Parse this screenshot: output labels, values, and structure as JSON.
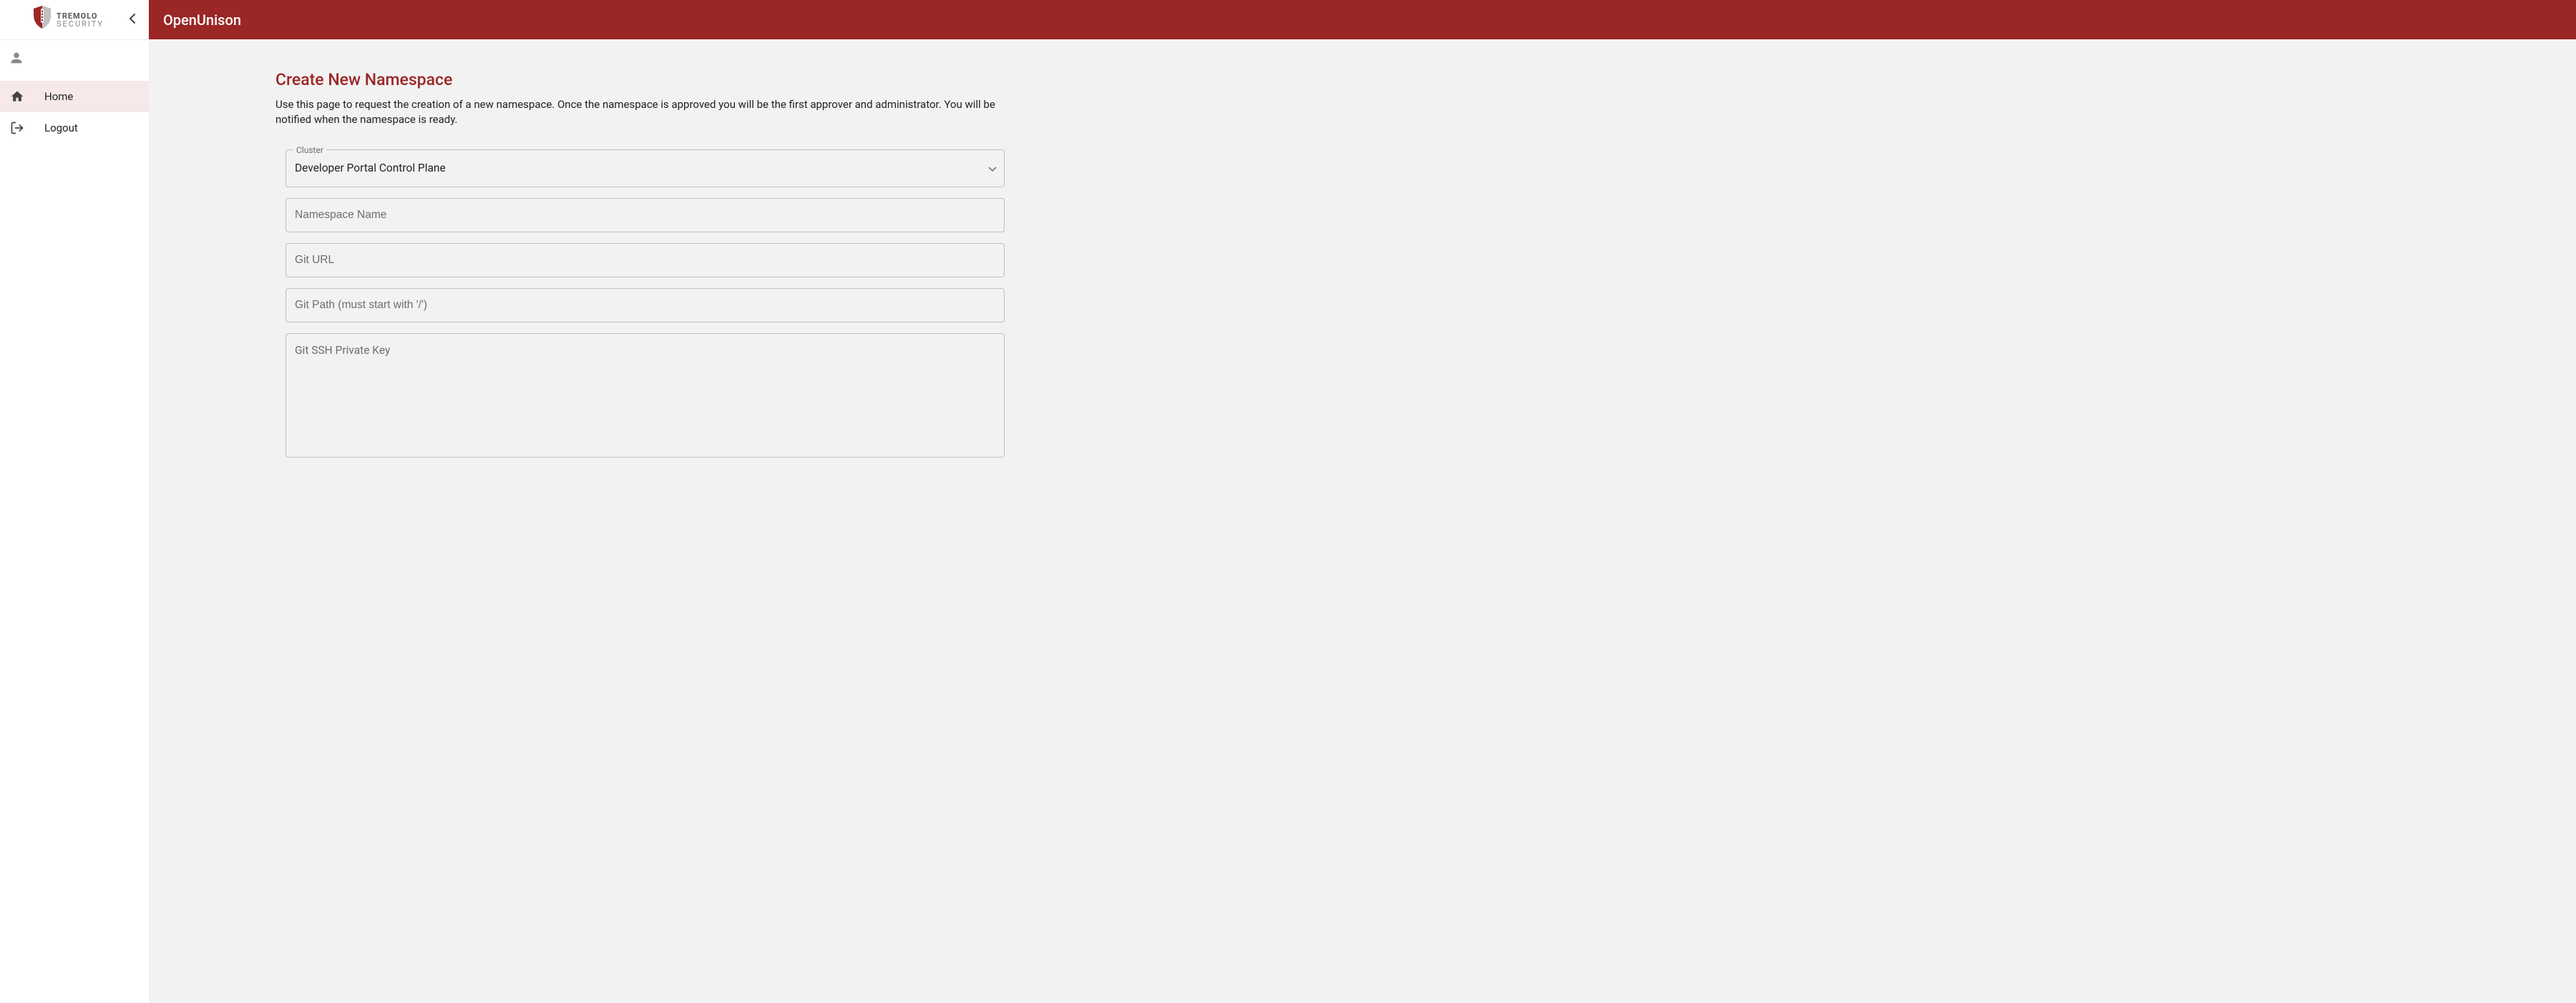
{
  "brand": {
    "name_line1": "TREMOLO",
    "name_line2": "SECURITY"
  },
  "header": {
    "title": "OpenUnison"
  },
  "sidebar": {
    "items": [
      {
        "label": "Home",
        "icon": "home",
        "active": true
      },
      {
        "label": "Logout",
        "icon": "logout",
        "active": false
      }
    ]
  },
  "page": {
    "title": "Create New Namespace",
    "description": "Use this page to request the creation of a new namespace. Once the namespace is approved you will be the first approver and administrator. You will be notified when the namespace is ready."
  },
  "form": {
    "cluster_label": "Cluster",
    "cluster_value": "Developer Portal Control Plane",
    "namespace_name_placeholder": "Namespace Name",
    "git_url_placeholder": "Git URL",
    "git_path_placeholder": "Git Path (must start with '/')",
    "git_ssh_key_placeholder": "Git SSH Private Key"
  }
}
